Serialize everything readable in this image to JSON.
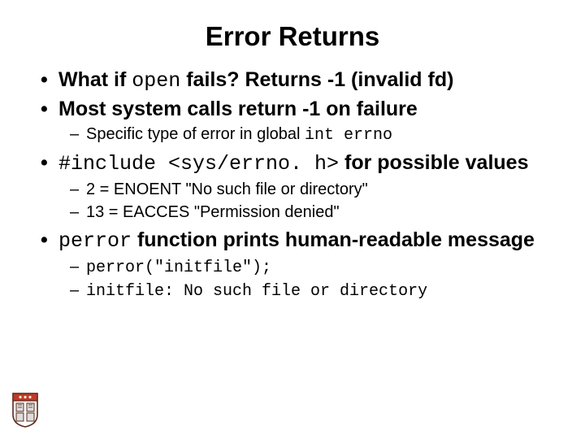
{
  "title": "Error Returns",
  "b1": {
    "pre": "What if ",
    "code": "open",
    "post": " fails? Returns -1 (invalid fd)"
  },
  "b2": "Most system calls return -1 on failure",
  "b2s1": {
    "pre": "Specific type of error  in global ",
    "code": "int errno"
  },
  "b3": {
    "code": "#include <sys/errno. h>",
    "post": " for possible values"
  },
  "b3s1": "2 = ENOENT \"No such file or directory\"",
  "b3s2": "13 = EACCES \"Permission denied\"",
  "b4": {
    "code": "perror",
    "post": " function prints human-readable message"
  },
  "b4s1": "perror(\"initfile\");",
  "b4s2": "initfile: No such file or directory"
}
